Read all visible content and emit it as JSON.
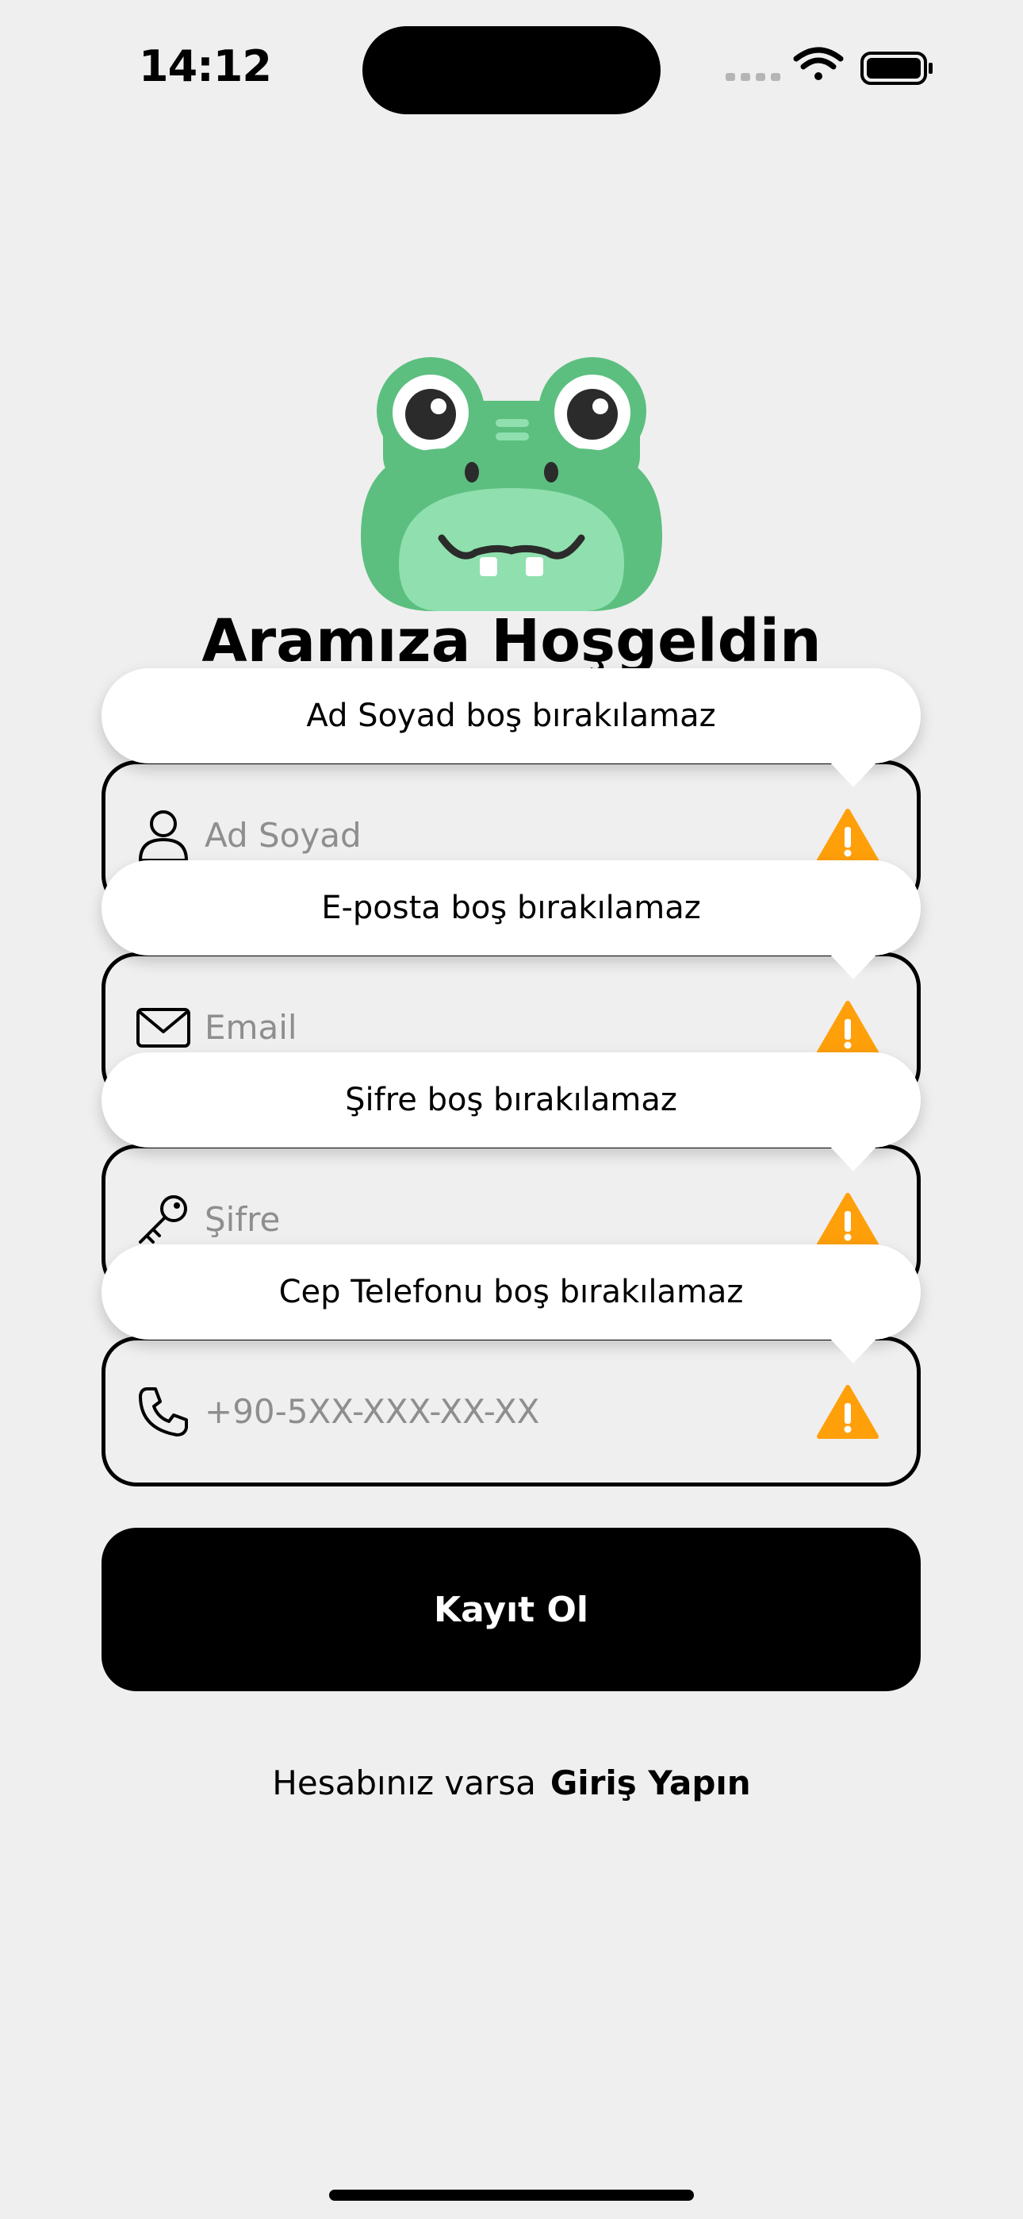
{
  "status_bar": {
    "time": "14:12"
  },
  "welcome_title": "Aramıza Hoşgeldin",
  "fields": [
    {
      "name": "full-name",
      "placeholder": "Ad Soyad",
      "value": "",
      "icon": "person-icon",
      "error": "Ad Soyad boş bırakılamaz"
    },
    {
      "name": "email",
      "placeholder": "Email",
      "value": "",
      "icon": "envelope-icon",
      "error": "E-posta boş bırakılamaz"
    },
    {
      "name": "password",
      "placeholder": "Şifre",
      "value": "",
      "icon": "key-icon",
      "error": "Şifre boş bırakılamaz"
    },
    {
      "name": "phone",
      "placeholder": "+90-5XX-XXX-XX-XX",
      "value": "",
      "icon": "phone-icon",
      "error": "Cep Telefonu boş bırakılamaz"
    }
  ],
  "register_button": "Kayıt Ol",
  "login_prompt": {
    "text": "Hesabınız varsa",
    "link": "Giriş Yapın"
  },
  "colors": {
    "background": "#efefef",
    "warning": "#ff9f0a",
    "mascot_green": "#5cbf7f",
    "mascot_light": "#8fe0ae",
    "button": "#000000"
  }
}
